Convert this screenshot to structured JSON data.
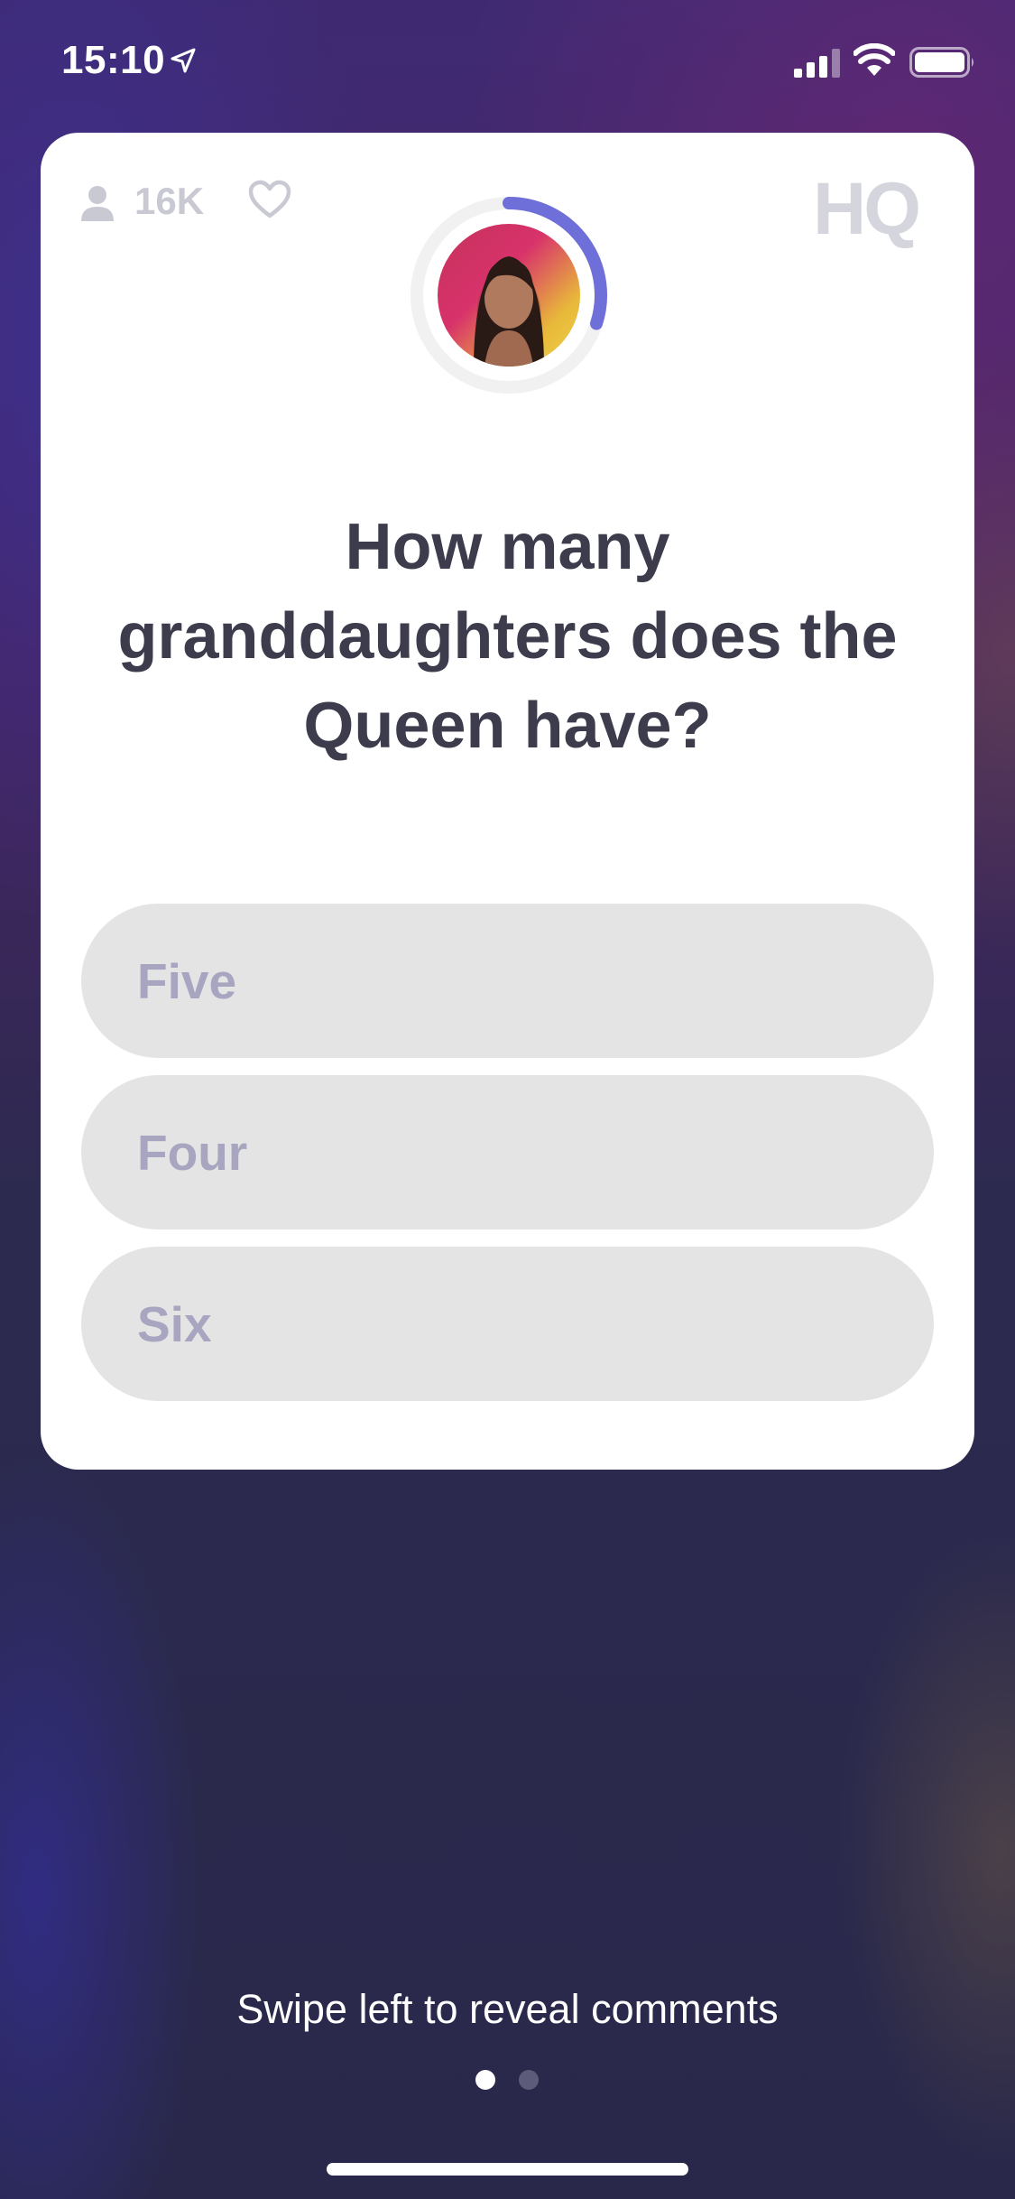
{
  "status_bar": {
    "time": "15:10",
    "icons": [
      "location-arrow-icon",
      "signal-icon",
      "wifi-icon",
      "battery-icon"
    ]
  },
  "card": {
    "viewer_icon": "person-icon",
    "viewer_count": "16K",
    "like_icon": "heart-icon",
    "logo": "HQ",
    "timer_progress": 0.3,
    "question": "How many granddaughters does the Queen have?",
    "answers": [
      "Five",
      "Four",
      "Six"
    ]
  },
  "footer": {
    "hint": "Swipe left to reveal comments",
    "page_indicator": {
      "current": 1,
      "total": 2
    }
  },
  "colors": {
    "card_background": "#ffffff",
    "question_text": "#3c3c4d",
    "answer_background": "#e4e4e4",
    "answer_text": "#a8a5c0",
    "timer_accent": "#6e6fd8"
  }
}
